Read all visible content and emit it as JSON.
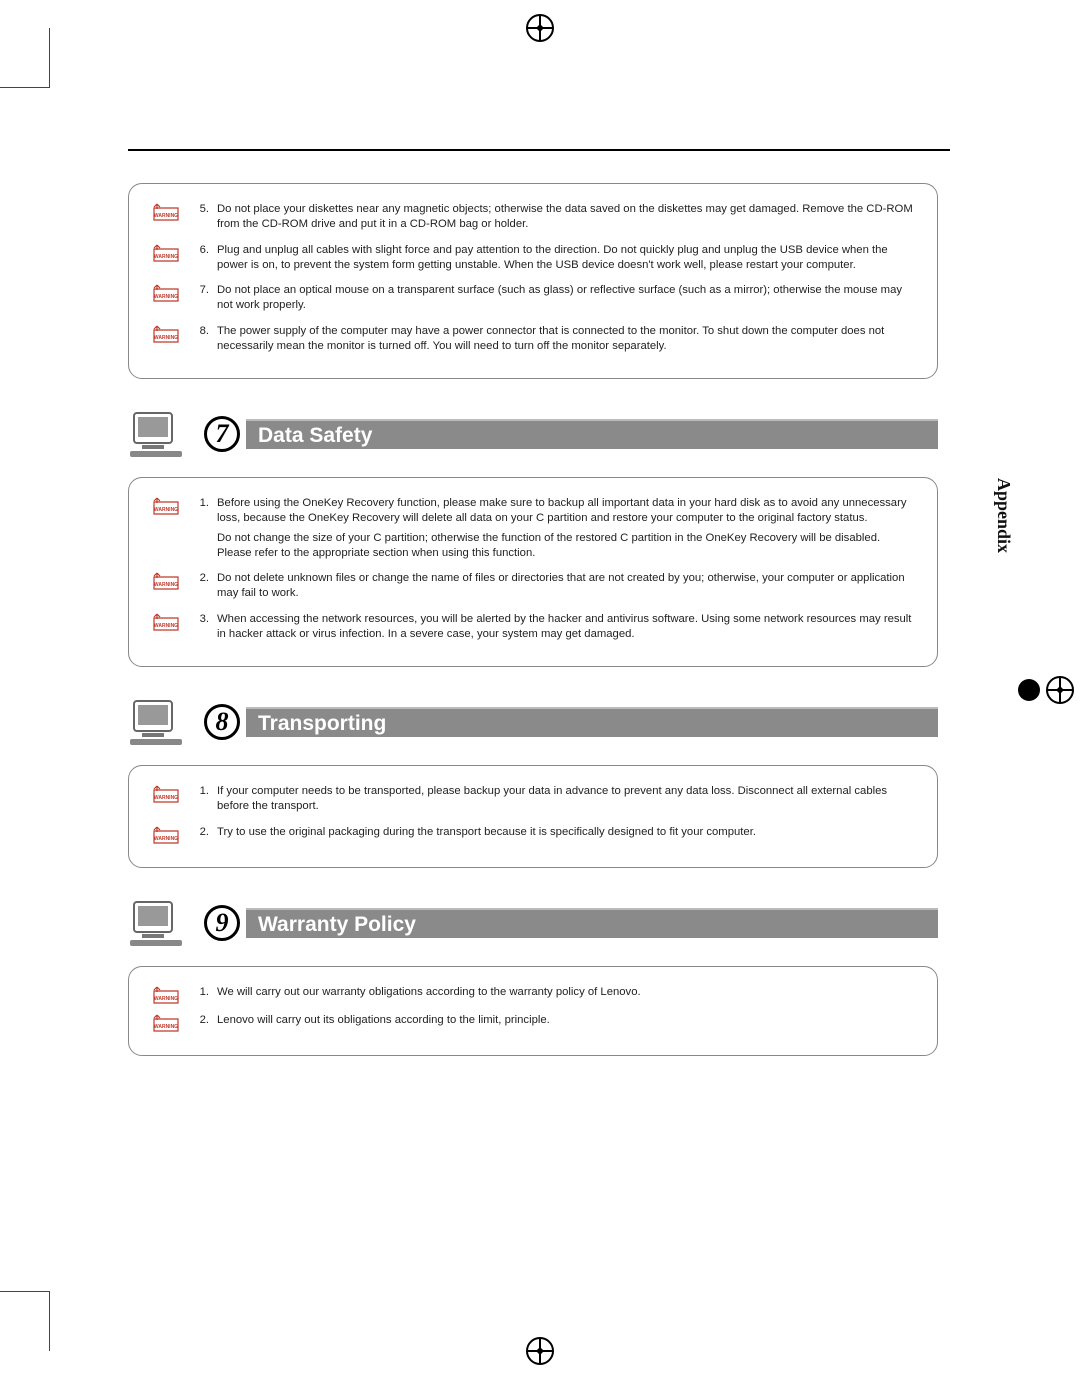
{
  "sideLabel": "Appendix",
  "continuedBox": {
    "items": [
      {
        "num": "5.",
        "text": "Do not place your diskettes near any magnetic objects; otherwise the data saved on the diskettes may get damaged. Remove the CD-ROM from the CD-ROM drive and put it in a CD-ROM bag or holder."
      },
      {
        "num": "6.",
        "text": "Plug and unplug all cables with slight force and pay attention to the direction. Do not quickly plug and unplug the USB device when the power is on, to prevent the system form getting unstable. When the USB device doesn't work well, please restart your computer."
      },
      {
        "num": "7.",
        "text": "Do not place an optical mouse on a transparent surface (such as glass) or reflective surface (such as a mirror); otherwise the mouse may not work properly."
      },
      {
        "num": "8.",
        "text": "The power supply of the computer may have a power connector that is connected to the monitor. To shut down the computer does not necessarily mean the monitor is turned off. You will need to turn off the monitor separately."
      }
    ]
  },
  "sections": [
    {
      "number": "7",
      "title": "Data Safety",
      "items": [
        {
          "num": "1.",
          "paras": [
            "Before using the OneKey Recovery function, please make sure to backup all important data in your hard disk as to avoid any unnecessary loss, because the OneKey Recovery will delete all data on your C partition and restore your computer to the original factory status.",
            "Do not change the size of your C partition; otherwise the function of the restored C partition in the OneKey Recovery will be disabled. Please refer to the appropriate section when using this function."
          ]
        },
        {
          "num": "2.",
          "paras": [
            "Do not delete unknown files or change the name of files or directories that are not created by you; otherwise, your computer or application may fail to work."
          ]
        },
        {
          "num": "3.",
          "paras": [
            "When accessing the network resources, you will be alerted by the hacker and antivirus software. Using some network resources may result in hacker attack or virus infection. In a severe case, your system may get damaged."
          ]
        }
      ]
    },
    {
      "number": "8",
      "title": "Transporting",
      "items": [
        {
          "num": "1.",
          "paras": [
            "If your computer needs to be transported, please backup your data in advance to prevent any data loss. Disconnect all external cables before the transport."
          ]
        },
        {
          "num": "2.",
          "paras": [
            "Try to use the original packaging during the transport because it is specifically designed to fit your computer."
          ]
        }
      ]
    },
    {
      "number": "9",
      "title": "Warranty Policy",
      "items": [
        {
          "num": "1.",
          "paras": [
            "We will carry out our warranty obligations according to the warranty policy of Lenovo."
          ]
        },
        {
          "num": "2.",
          "paras": [
            "Lenovo will carry out its obligations according to the limit, principle."
          ]
        }
      ]
    }
  ]
}
